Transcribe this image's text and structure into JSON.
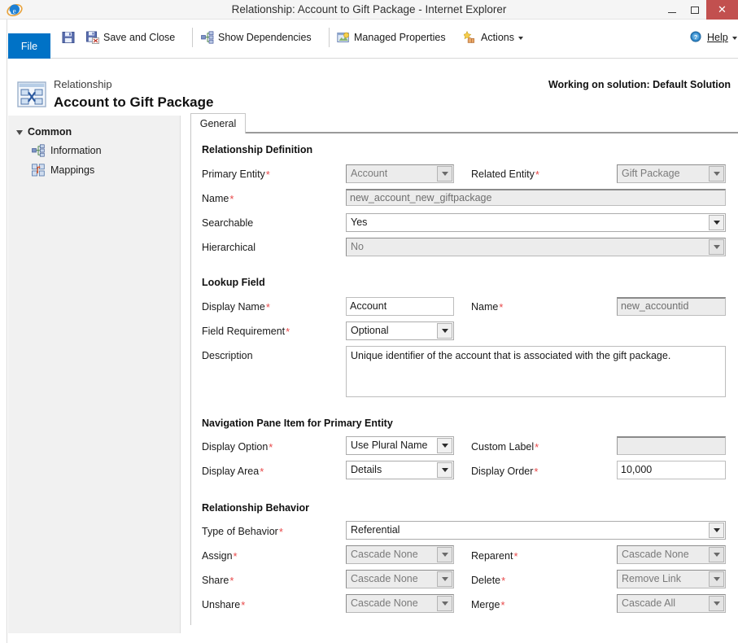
{
  "window": {
    "title": "Relationship: Account to Gift Package - Internet Explorer",
    "app_icon": "internet-explorer-icon",
    "minimize_label": "–",
    "maximize_label": "□",
    "close_label": "✕"
  },
  "ribbon": {
    "file_label": "File",
    "save_icon": "save-icon",
    "save_and_close_icon": "save-and-close-icon",
    "save_and_close_label": "Save and Close",
    "show_dependencies_icon": "dependencies-icon",
    "show_dependencies_label": "Show Dependencies",
    "managed_properties_icon": "managed-properties-icon",
    "managed_properties_label": "Managed Properties",
    "actions_icon": "actions-icon",
    "actions_label": "Actions",
    "help_icon": "help-icon",
    "help_label": "Help"
  },
  "header": {
    "icon": "relationship-icon",
    "kicker": "Relationship",
    "title": "Account to Gift Package",
    "solution": "Working on solution: Default Solution"
  },
  "sidebar": {
    "group_label": "Common",
    "items": [
      {
        "label": "Information",
        "icon": "information-icon"
      },
      {
        "label": "Mappings",
        "icon": "mappings-icon"
      }
    ]
  },
  "tabs": [
    {
      "label": "General",
      "active": true
    }
  ],
  "sections": {
    "relationship_definition": {
      "title": "Relationship Definition",
      "primary_entity": {
        "label": "Primary Entity",
        "required": "*",
        "value": "Account",
        "disabled": true
      },
      "related_entity": {
        "label": "Related Entity",
        "required": "*",
        "value": "Gift Package",
        "disabled": true
      },
      "name": {
        "label": "Name",
        "required": "*",
        "value": "new_account_new_giftpackage",
        "readonly": true
      },
      "searchable": {
        "label": "Searchable",
        "required": "",
        "value": "Yes",
        "disabled": false
      },
      "hierarchical": {
        "label": "Hierarchical",
        "required": "",
        "value": "No",
        "disabled": true
      }
    },
    "lookup_field": {
      "title": "Lookup Field",
      "display_name": {
        "label": "Display Name",
        "required": "*",
        "value": "Account"
      },
      "name": {
        "label": "Name",
        "required": "*",
        "value": "new_accountid",
        "readonly": true
      },
      "field_requirement": {
        "label": "Field Requirement",
        "required": "*",
        "value": "Optional"
      },
      "description": {
        "label": "Description",
        "required": "",
        "value": "Unique identifier of the account that is associated with the gift package."
      }
    },
    "navigation_pane": {
      "title": "Navigation Pane Item for Primary Entity",
      "display_option": {
        "label": "Display Option",
        "required": "*",
        "value": "Use Plural Name"
      },
      "custom_label": {
        "label": "Custom Label",
        "required": "*",
        "value": "",
        "disabled": true
      },
      "display_area": {
        "label": "Display Area",
        "required": "*",
        "value": "Details"
      },
      "display_order": {
        "label": "Display Order",
        "required": "*",
        "value": "10,000"
      }
    },
    "relationship_behavior": {
      "title": "Relationship Behavior",
      "type_of_behavior": {
        "label": "Type of Behavior",
        "required": "*",
        "value": "Referential"
      },
      "assign": {
        "label": "Assign",
        "required": "*",
        "value": "Cascade None",
        "disabled": true
      },
      "reparent": {
        "label": "Reparent",
        "required": "*",
        "value": "Cascade None",
        "disabled": true
      },
      "share": {
        "label": "Share",
        "required": "*",
        "value": "Cascade None",
        "disabled": true
      },
      "delete": {
        "label": "Delete",
        "required": "*",
        "value": "Remove Link",
        "disabled": true
      },
      "unshare": {
        "label": "Unshare",
        "required": "*",
        "value": "Cascade None",
        "disabled": true
      },
      "merge": {
        "label": "Merge",
        "required": "*",
        "value": "Cascade All",
        "disabled": true
      }
    }
  },
  "colors": {
    "accent": "#0072c6",
    "close": "#c2504f",
    "required": "#e8494a",
    "sidebar_bg": "#f1f1f1"
  }
}
